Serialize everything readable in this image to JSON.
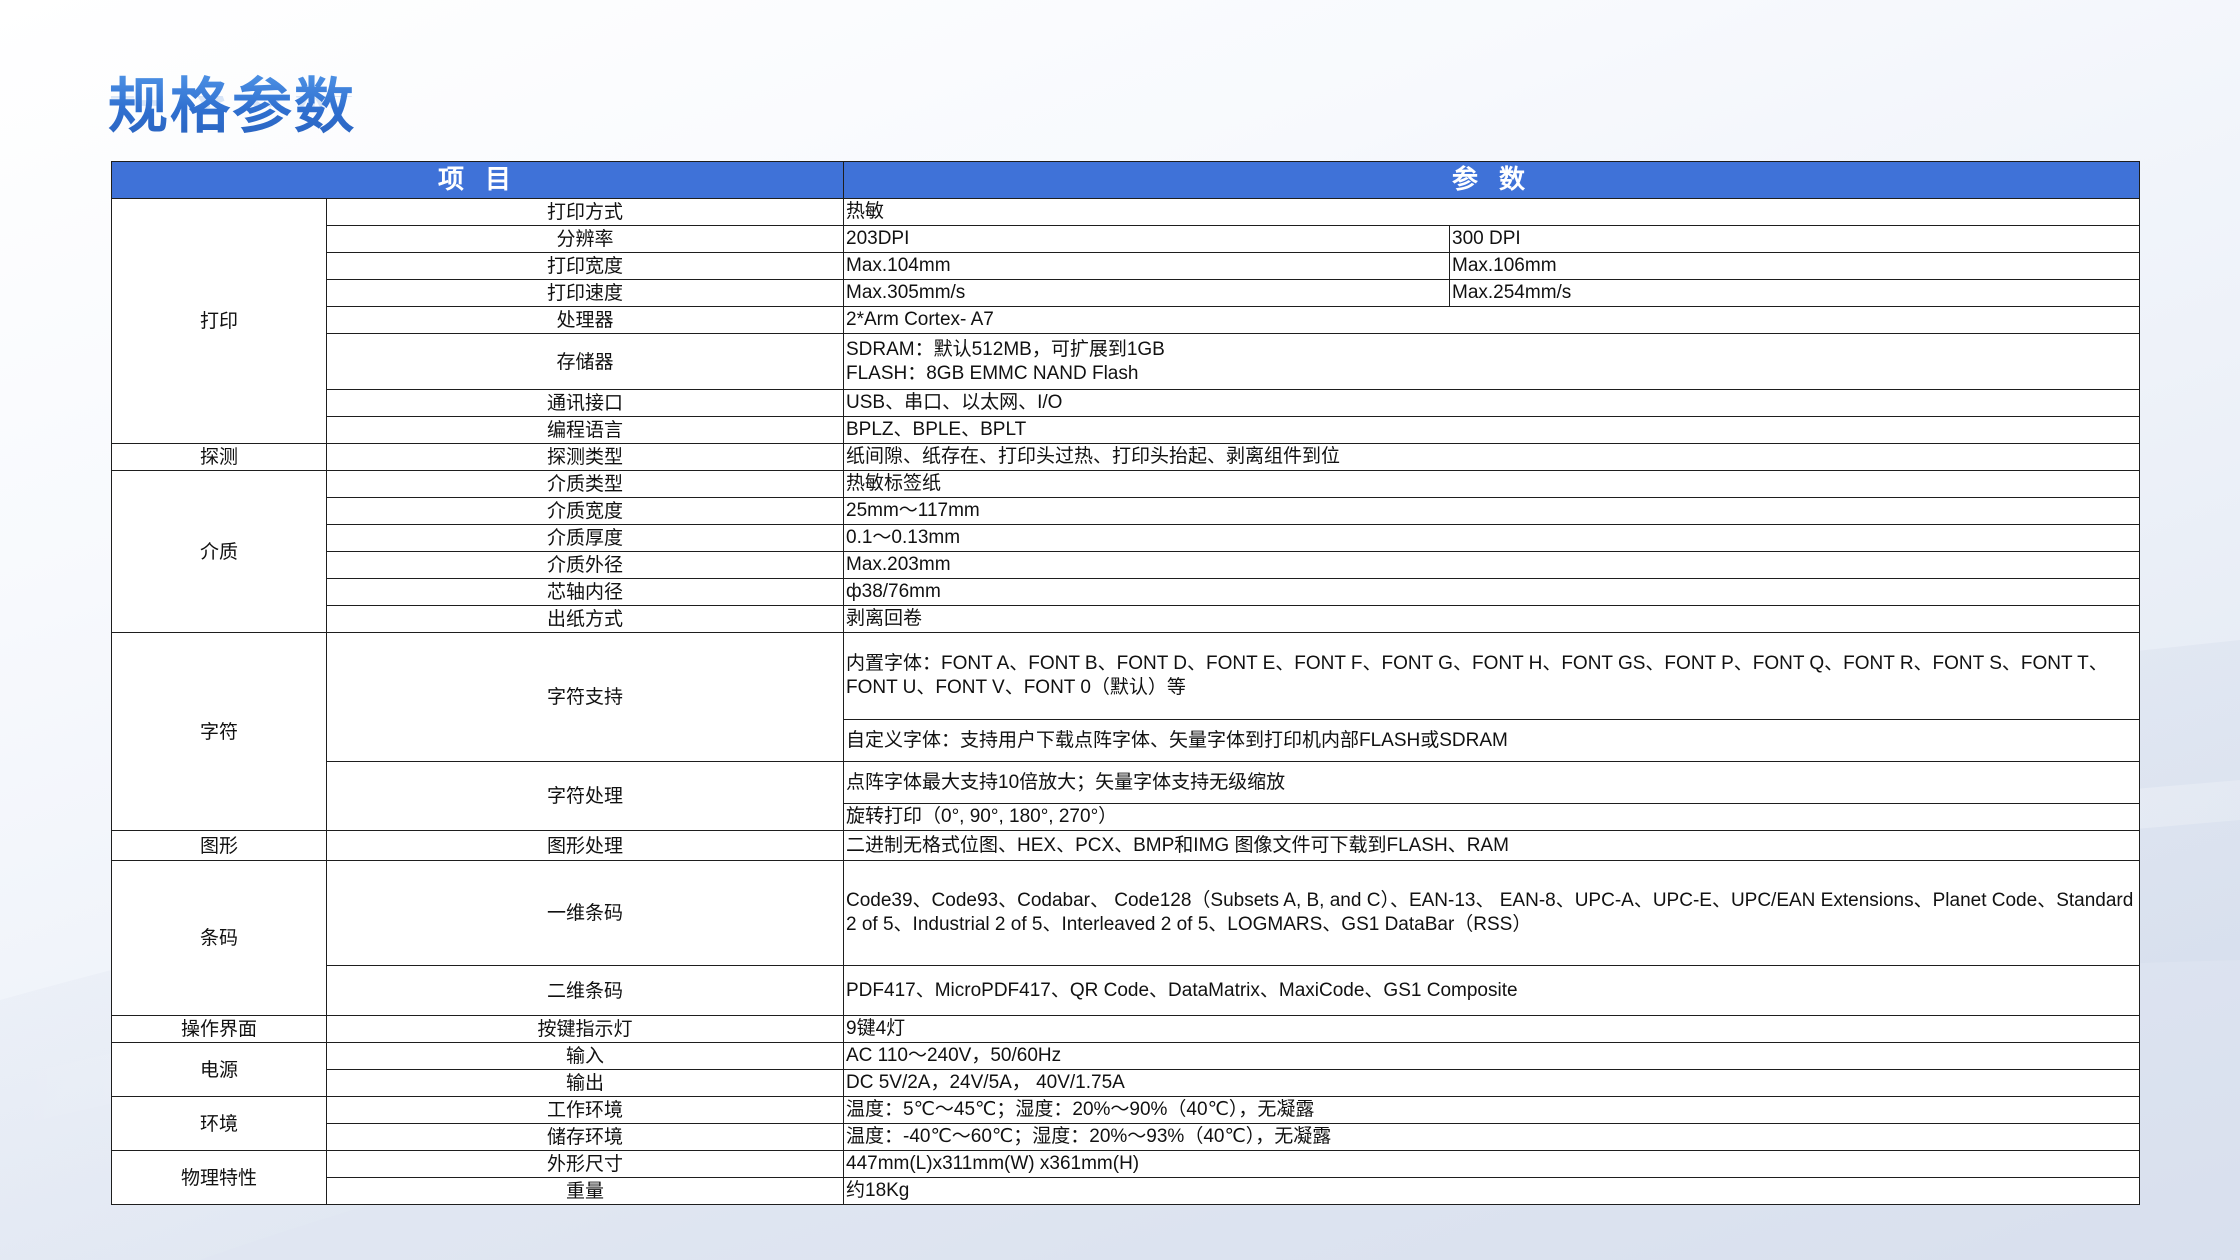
{
  "title": "规格参数",
  "header": {
    "item_label": "项 目",
    "param_label": "参 数"
  },
  "rows": {
    "print_method": {
      "cat": "打印",
      "item": "打印方式",
      "value": "热敏"
    },
    "resolution": {
      "item": "分辨率",
      "v1": "203DPI",
      "v2": "300 DPI"
    },
    "print_width": {
      "item": "打印宽度",
      "v1": "Max.104mm",
      "v2": "Max.106mm"
    },
    "print_speed": {
      "item": "打印速度",
      "v1": "Max.305mm/s",
      "v2": "Max.254mm/s"
    },
    "processor": {
      "item": "处理器",
      "value": "2*Arm Cortex- A7"
    },
    "storage": {
      "item": "存储器",
      "line1": "SDRAM：默认512MB，可扩展到1GB",
      "line2": "FLASH：8GB EMMC NAND Flash"
    },
    "interface": {
      "item": "通讯接口",
      "value": "USB、串口、以太网、I/O"
    },
    "language": {
      "item": "编程语言",
      "value": "BPLZ、BPLE、BPLT"
    },
    "detect": {
      "cat": "探测",
      "item": "探测类型",
      "value": "纸间隙、纸存在、打印头过热、打印头抬起、剥离组件到位"
    },
    "media_type": {
      "cat": "介质",
      "item": "介质类型",
      "value": "热敏标签纸"
    },
    "media_width": {
      "item": "介质宽度",
      "value": "25mm～117mm"
    },
    "media_thickness": {
      "item": "介质厚度",
      "value": "0.1～0.13mm"
    },
    "media_od": {
      "item": "介质外径",
      "value": "Max.203mm"
    },
    "core_id": {
      "item": "芯轴内径",
      "value": "ф38/76mm"
    },
    "output_mode": {
      "item": "出纸方式",
      "value": "剥离回卷"
    },
    "font_support": {
      "cat": "字符",
      "item": "字符支持",
      "value1": "内置字体：FONT A、FONT B、FONT D、FONT E、FONT F、FONT G、FONT H、FONT GS、FONT P、FONT Q、FONT R、FONT S、FONT T、FONT U、FONT V、FONT 0（默认）等",
      "value2": "自定义字体：支持用户下载点阵字体、矢量字体到打印机内部FLASH或SDRAM"
    },
    "font_processing": {
      "item": "字符处理",
      "value1": "点阵字体最大支持10倍放大；矢量字体支持无级缩放",
      "value2": "旋转打印（0°, 90°, 180°, 270°）"
    },
    "graphics": {
      "cat": "图形",
      "item": "图形处理",
      "value": "二进制无格式位图、HEX、PCX、BMP和IMG 图像文件可下载到FLASH、RAM"
    },
    "barcode_1d": {
      "cat": "条码",
      "item": "一维条码",
      "value": "Code39、Code93、Codabar、 Code128（Subsets A, B, and C）、EAN-13、 EAN-8、UPC-A、UPC-E、UPC/EAN Extensions、Planet Code、Standard 2 of 5、Industrial 2 of 5、Interleaved 2 of 5、LOGMARS、GS1 DataBar（RSS）"
    },
    "barcode_2d": {
      "item": "二维条码",
      "value": "PDF417、MicroPDF417、QR Code、DataMatrix、MaxiCode、GS1 Composite"
    },
    "ui": {
      "cat": "操作界面",
      "item": "按键指示灯",
      "value": "9键4灯"
    },
    "power_in": {
      "cat": "电源",
      "item": "输入",
      "value": "AC 110～240V，50/60Hz"
    },
    "power_out": {
      "item": "输出",
      "value": "DC 5V/2A，24V/5A， 40V/1.75A"
    },
    "env_work": {
      "cat": "环境",
      "item": "工作环境",
      "value": "温度：5℃～45℃；湿度：20%～90%（40℃），无凝露"
    },
    "env_store": {
      "item": "储存环境",
      "value": "温度：-40℃～60℃；湿度：20%～93%（40℃），无凝露"
    },
    "dimensions": {
      "cat": "物理特性",
      "item": "外形尺寸",
      "value": "447mm(L)x311mm(W) x361mm(H)"
    },
    "weight": {
      "item": "重量",
      "value": "约18Kg"
    }
  }
}
